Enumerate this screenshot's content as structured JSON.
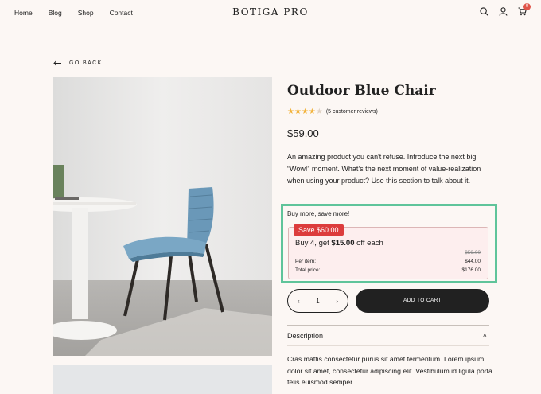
{
  "header": {
    "nav": [
      "Home",
      "Blog",
      "Shop",
      "Contact"
    ],
    "logo": "BOTIGA PRO",
    "cart_count": "0"
  },
  "back": {
    "label": "GO BACK"
  },
  "product": {
    "title": "Outdoor Blue Chair",
    "rating": 4,
    "reviews_text": "(5 customer reviews)",
    "price": "$59.00",
    "description": "An amazing product you can't refuse. Introduce the next big “Wow!” moment. What’s the next moment of value-realization when using your product? Use this section to talk about it."
  },
  "bulk": {
    "heading": "Buy more, save more!",
    "save_badge": "Save $60.00",
    "line_prefix": "Buy 4, get ",
    "line_amount": "$15.00",
    "line_suffix": " off each",
    "old_price": "$59.00",
    "per_item_label": "Per item:",
    "per_item_value": "$44.00",
    "total_label": "Total price:",
    "total_value": "$176.00"
  },
  "purchase": {
    "quantity": "1",
    "minus": "‹",
    "plus": "›",
    "add_to_cart": "ADD TO CART"
  },
  "accordion": {
    "title": "Description",
    "chevron": "˄",
    "body": "Cras mattis consectetur purus sit amet fermentum. Lorem ipsum dolor sit amet, consectetur adipiscing elit. Vestibulum id ligula porta felis euismod semper."
  },
  "colors": {
    "background": "#fcf7f4",
    "highlight": "#5fc49a",
    "badge": "#dc3c3c",
    "star": "#f2b33d"
  }
}
